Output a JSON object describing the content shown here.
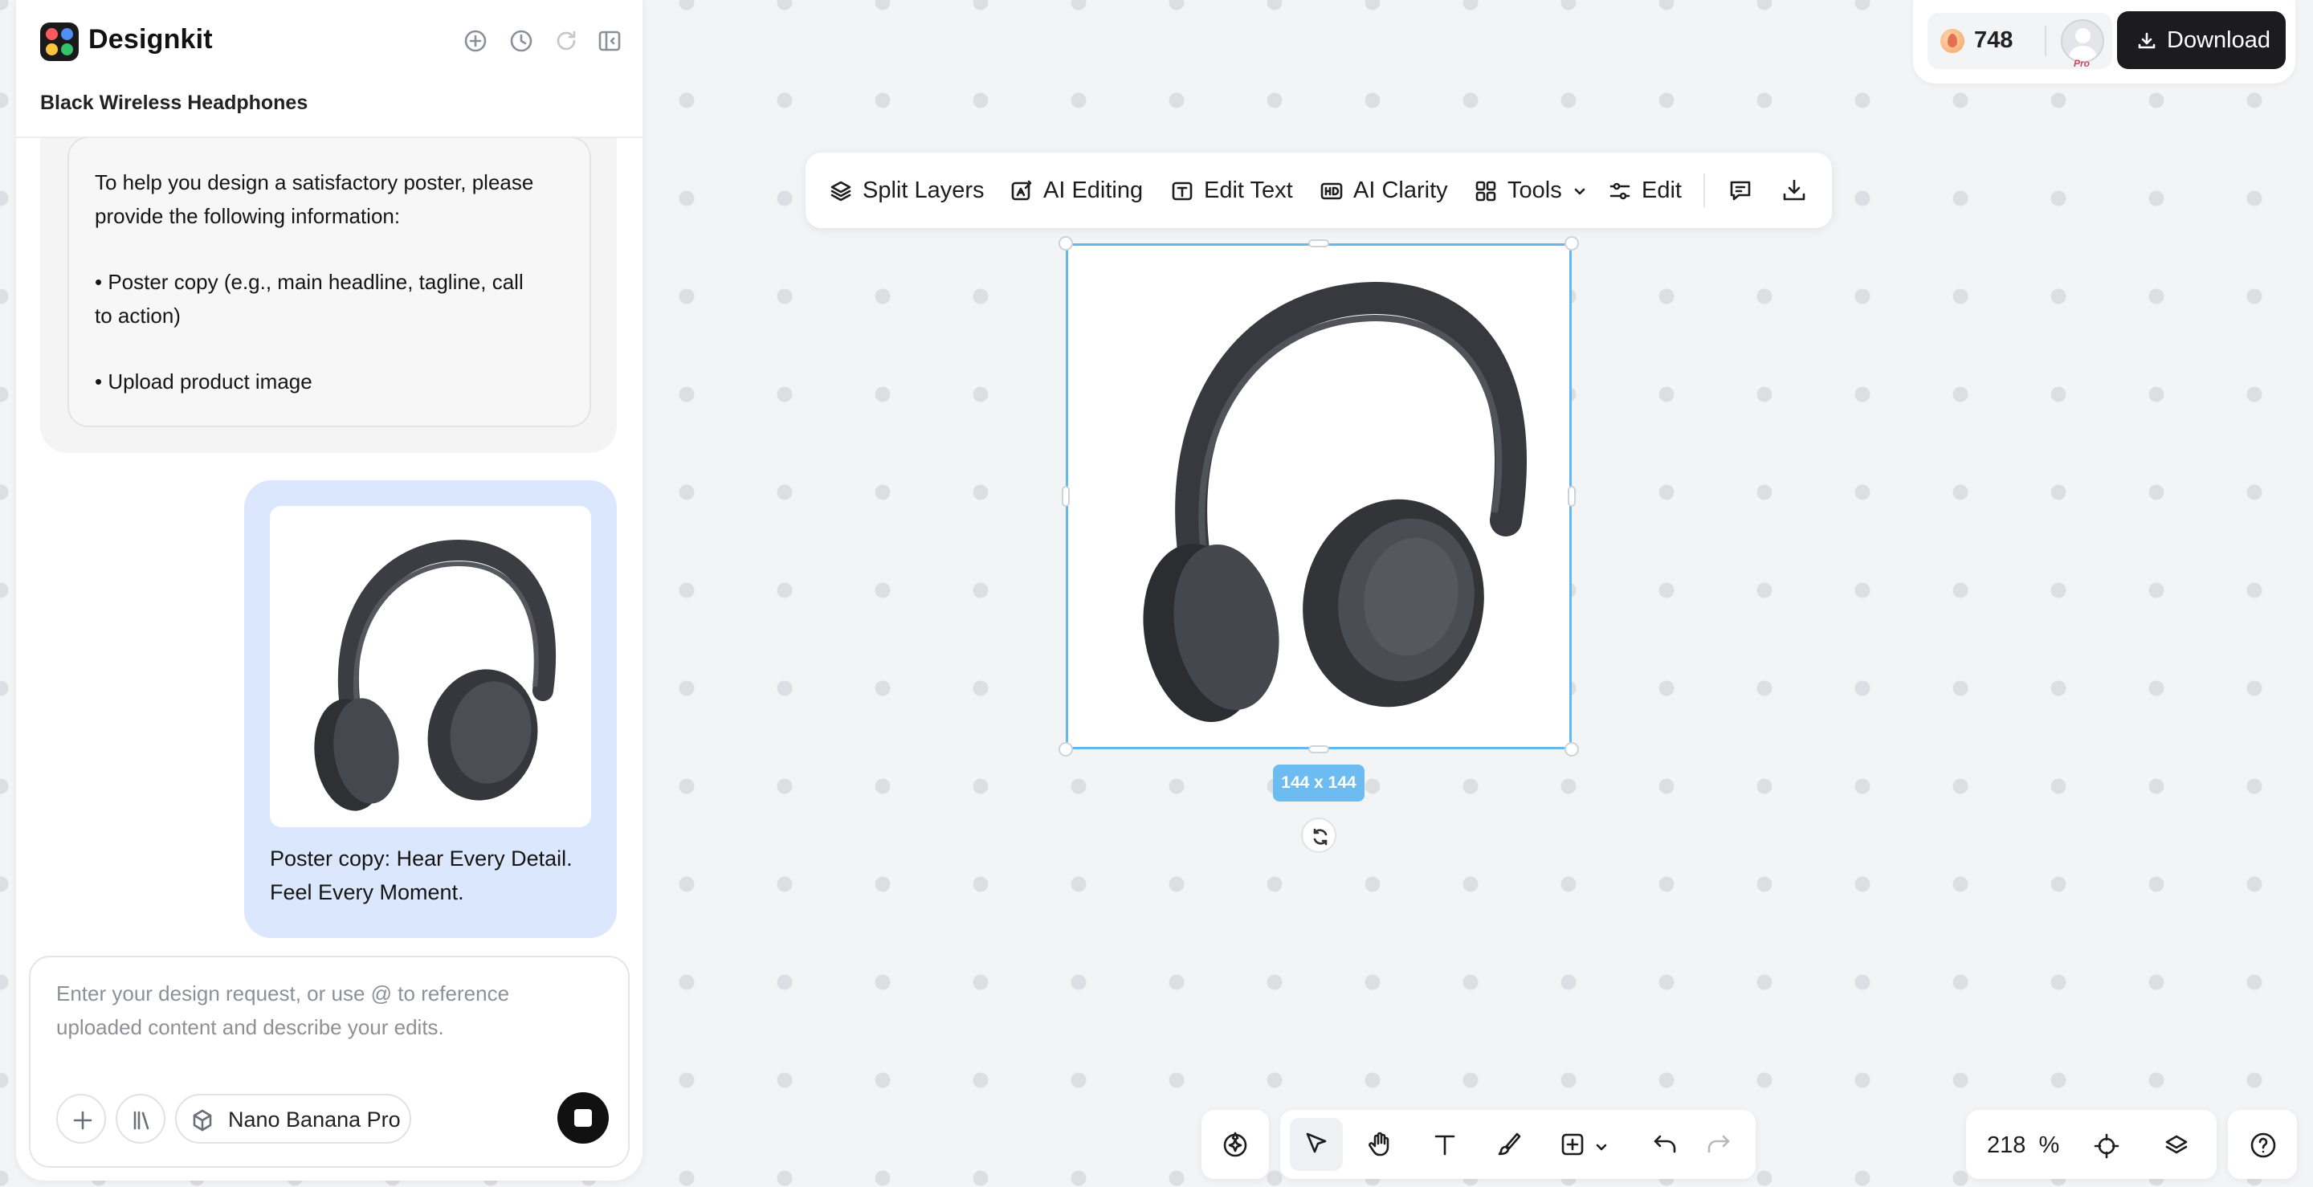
{
  "app": {
    "name": "Designkit",
    "project_title": "Black Wireless Headphones"
  },
  "header_icons": [
    "new-chat-icon",
    "history-icon",
    "refresh-icon",
    "collapse-panel-icon"
  ],
  "chat": {
    "assistant_message": {
      "lines": [
        "To help you design a satisfactory poster, please",
        "provide the following information:",
        "• Poster copy (e.g., main headline, tagline, call",
        "to action)",
        "• Upload product image"
      ]
    },
    "user_message": {
      "image": "black-headphones-photo",
      "lines": [
        "Poster copy: Hear Every Detail.",
        "Feel Every Moment."
      ]
    }
  },
  "composer": {
    "placeholder_lines": [
      "Enter your design request, or use @ to reference",
      "uploaded content and describe your edits."
    ],
    "model_label": "Nano Banana Pro"
  },
  "account": {
    "credits": "748",
    "plan_badge": "Pro",
    "download_label": "Download"
  },
  "toolbar": {
    "split_layers": "Split Layers",
    "ai_editing": "AI Editing",
    "edit_text": "Edit Text",
    "ai_clarity": "AI Clarity",
    "tools": "Tools",
    "edit": "Edit"
  },
  "canvas": {
    "size_label": "144 x 144",
    "zoom": "218",
    "zoom_unit": "%"
  },
  "colors": {
    "selection": "#63b8ef",
    "user_bubble": "#dbe7fd",
    "primary_dark": "#1c1c1e"
  }
}
